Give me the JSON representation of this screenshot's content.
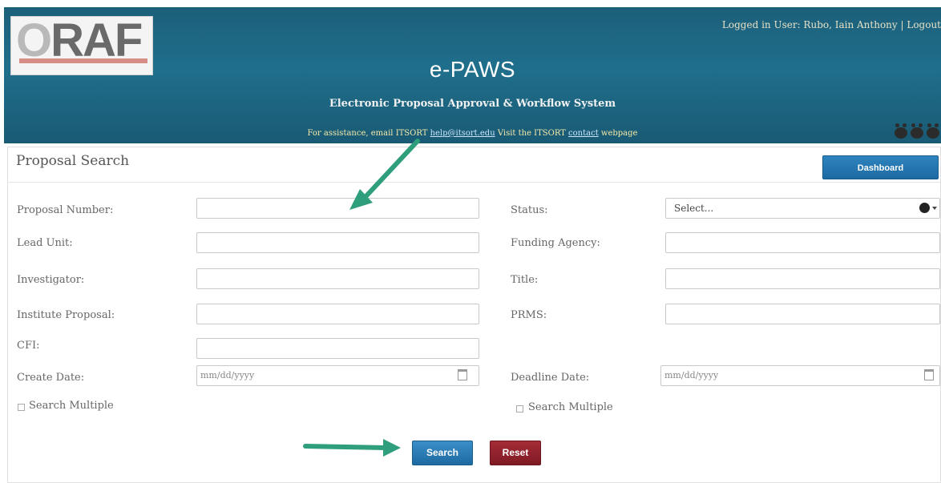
{
  "header": {
    "logo_text_lead": "O",
    "logo_text_rest": "RAF",
    "user_info": "Logged in User: Rubo, Iain Anthony | Logout",
    "app_title": "e-PAWS",
    "app_subtitle": "Electronic Proposal Approval & Workflow System",
    "help_prefix": "For assistance, email ",
    "help_org": "ITSORT",
    "help_email": "help@itsort.edu",
    "help_visit": " Visit the ITSORT ",
    "help_link": "contact",
    "help_suffix": " webpage",
    "paw_icons": [
      "paw-icon",
      "paw-icon",
      "paw-icon"
    ]
  },
  "panel": {
    "title": "Proposal Search",
    "dashboard_label": "Dashboard"
  },
  "fields": {
    "proposal_number": "Proposal Number:",
    "lead_unit": "Lead Unit:",
    "investigator": "Investigator:",
    "institute_proposal": "Institute Proposal:",
    "cfi": "CFI:",
    "create_date": "Create Date:",
    "status": "Status:",
    "funding_agency": "Funding Agency:",
    "title": "Title:",
    "prms": "PRMS:",
    "deadline_date": "Deadline Date:"
  },
  "inputs": {
    "status_selected": "Select...",
    "create_date_placeholder": "mm/dd/yyyy",
    "deadline_date_placeholder": "mm/dd/yyyy"
  },
  "checkboxes": {
    "create_search_multiple": "Search Multiple",
    "deadline_search_multiple": "Search Multiple"
  },
  "buttons": {
    "search": "Search",
    "reset": "Reset"
  },
  "colors": {
    "header_bg": "#1f6f8c",
    "search_btn": "#2a7bb5",
    "reset_btn": "#8e1f2a",
    "annotation_arrow": "#2e9e7c"
  }
}
